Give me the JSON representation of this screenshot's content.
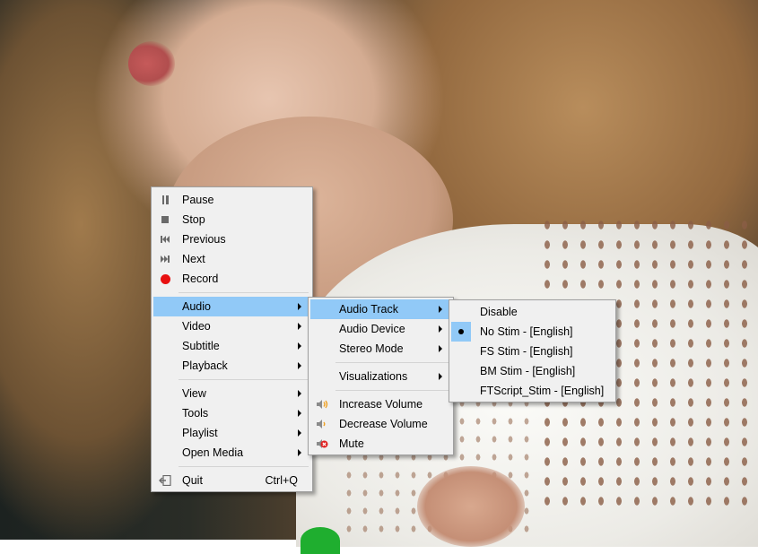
{
  "main_menu": {
    "items": [
      {
        "label": "Pause",
        "icon": "pause-icon"
      },
      {
        "label": "Stop",
        "icon": "stop-icon"
      },
      {
        "label": "Previous",
        "icon": "previous-icon"
      },
      {
        "label": "Next",
        "icon": "next-icon"
      },
      {
        "label": "Record",
        "icon": "record-icon"
      },
      {
        "label": "Audio"
      },
      {
        "label": "Video"
      },
      {
        "label": "Subtitle"
      },
      {
        "label": "Playback"
      },
      {
        "label": "View"
      },
      {
        "label": "Tools"
      },
      {
        "label": "Playlist"
      },
      {
        "label": "Open Media"
      },
      {
        "label": "Quit",
        "icon": "quit-icon",
        "shortcut": "Ctrl+Q"
      }
    ],
    "highlighted": "Audio"
  },
  "audio_menu": {
    "items": [
      {
        "label": "Audio Track"
      },
      {
        "label": "Audio Device"
      },
      {
        "label": "Stereo Mode"
      },
      {
        "label": "Visualizations"
      },
      {
        "label": "Increase Volume",
        "icon": "volume-up-icon"
      },
      {
        "label": "Decrease Volume",
        "icon": "volume-down-icon"
      },
      {
        "label": "Mute",
        "icon": "mute-icon"
      }
    ],
    "highlighted": "Audio Track"
  },
  "audio_track_menu": {
    "items": [
      {
        "label": "Disable"
      },
      {
        "label": "No Stim - [English]"
      },
      {
        "label": "FS Stim - [English]"
      },
      {
        "label": "BM Stim - [English]"
      },
      {
        "label": "FTScript_Stim - [English]"
      }
    ],
    "selected": "No Stim - [English]"
  },
  "colors": {
    "menu_bg": "#f0f0f0",
    "highlight": "#91c9f7",
    "record_red": "#e81010",
    "volume_orange": "#f0a020"
  }
}
